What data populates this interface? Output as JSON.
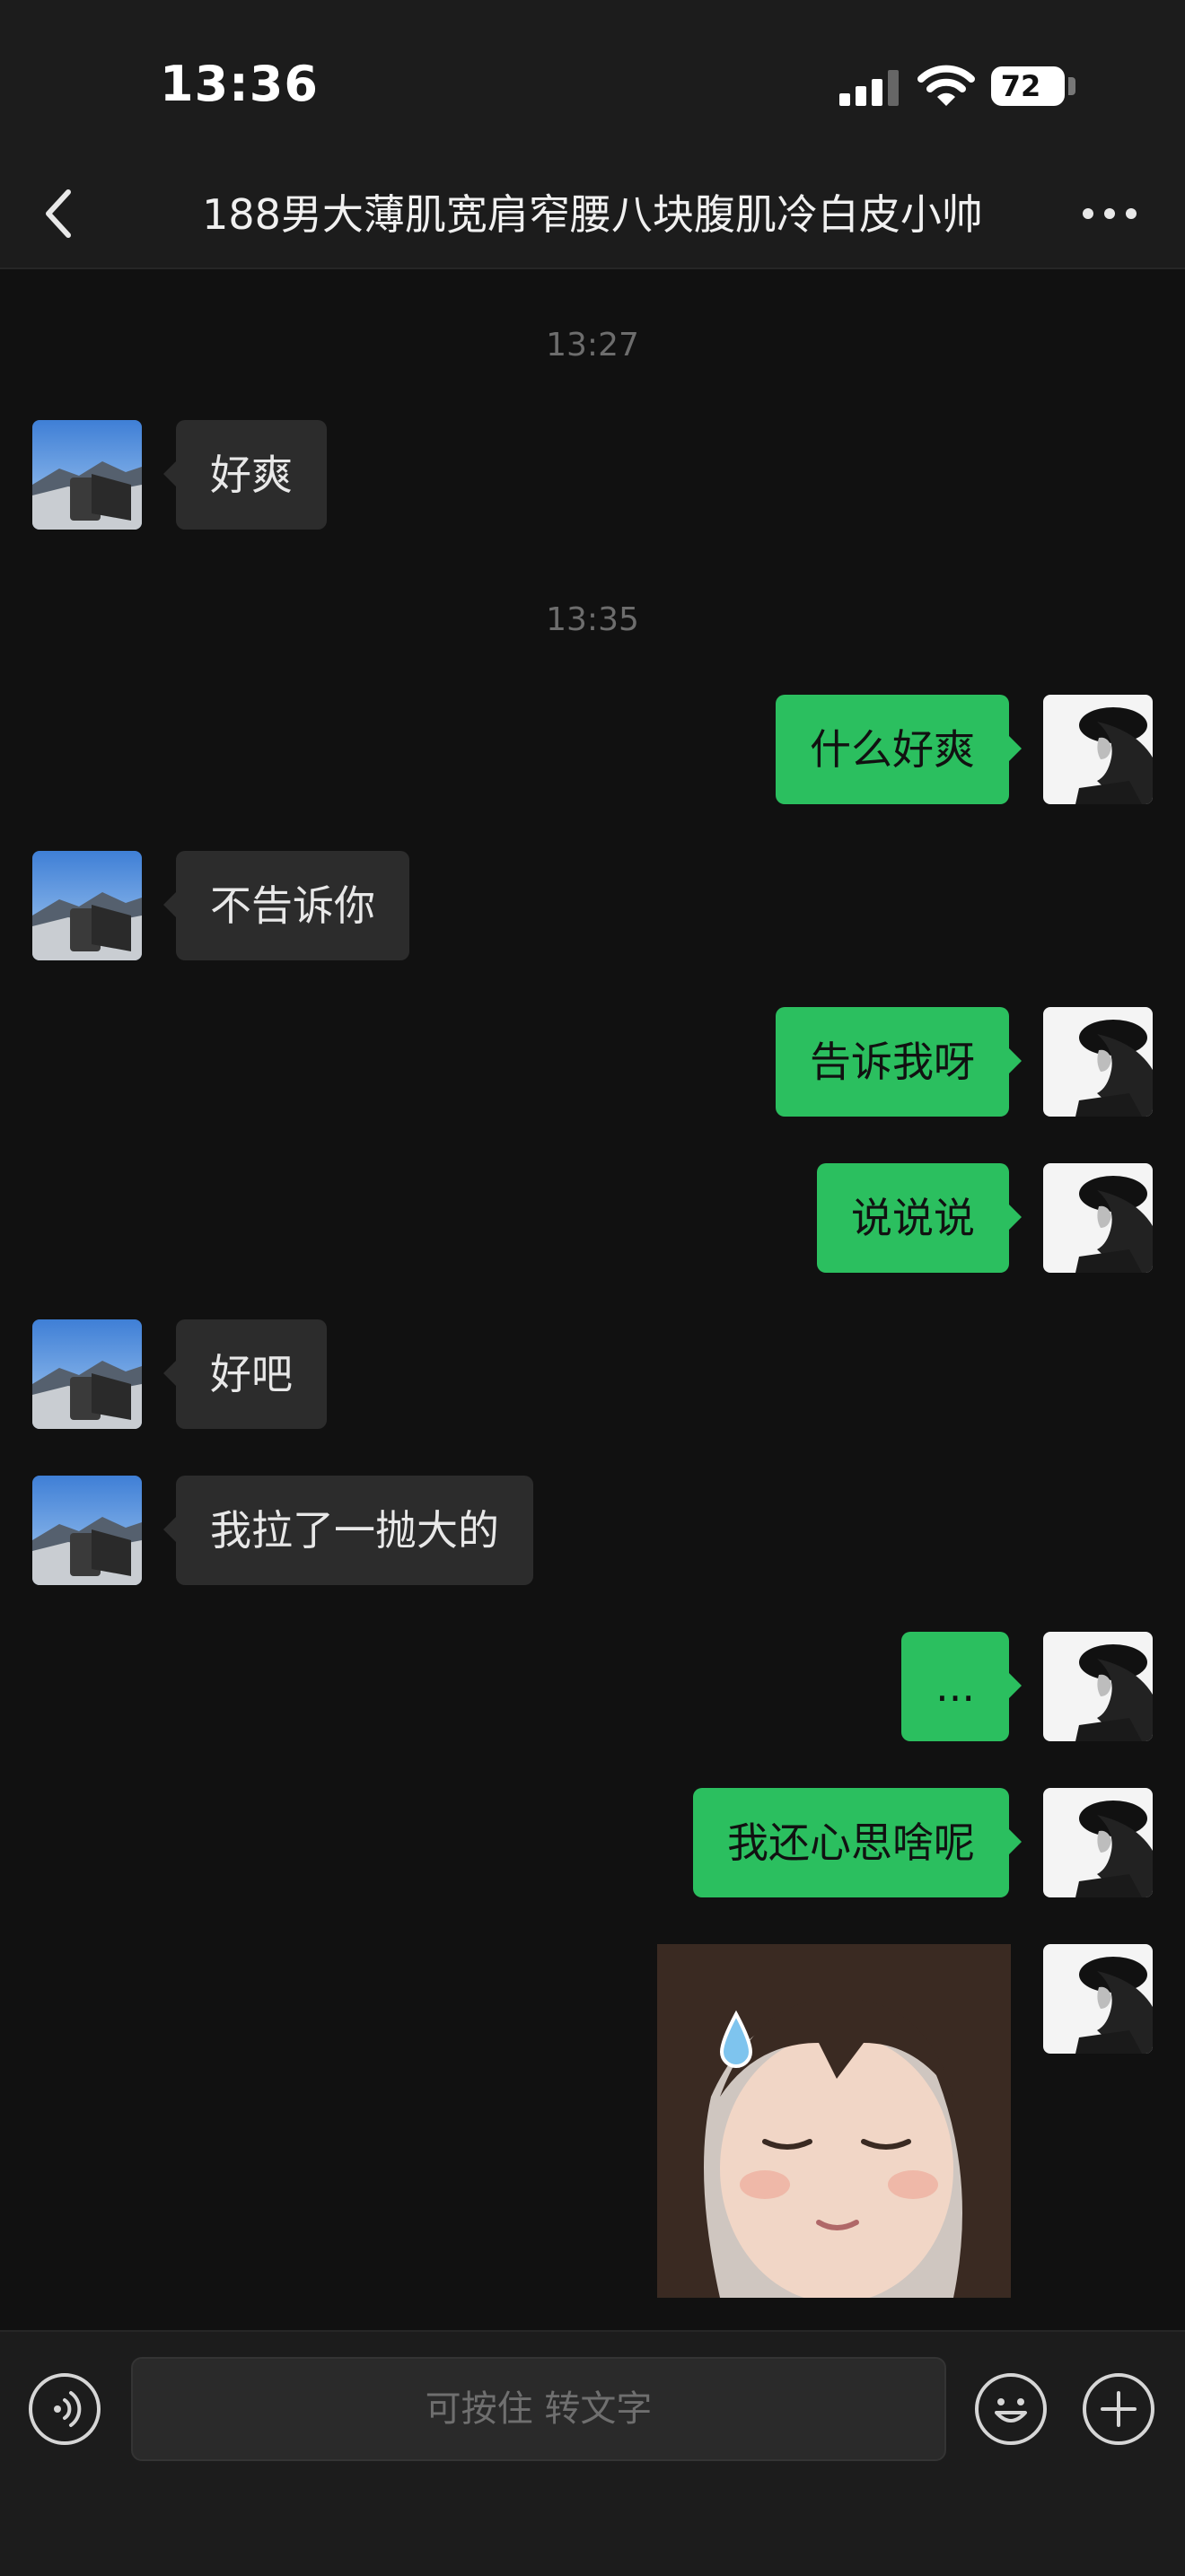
{
  "status_bar": {
    "time": "13:36",
    "battery": "72"
  },
  "nav": {
    "title": "188男大薄肌宽肩窄腰八块腹肌冷白皮小帅"
  },
  "chat": {
    "timestamps": [
      "13:27",
      "13:35"
    ],
    "messages": [
      {
        "from": "them",
        "text": "好爽"
      },
      {
        "from": "me",
        "text": "什么好爽"
      },
      {
        "from": "them",
        "text": "不告诉你"
      },
      {
        "from": "me",
        "text": "告诉我呀"
      },
      {
        "from": "me",
        "text": "说说说"
      },
      {
        "from": "them",
        "text": "好吧"
      },
      {
        "from": "them",
        "text": "我拉了一抛大的"
      },
      {
        "from": "me",
        "text": "..."
      },
      {
        "from": "me",
        "text": "我还心思啥呢"
      },
      {
        "from": "me",
        "type": "sticker"
      }
    ]
  },
  "input_bar": {
    "placeholder": "可按住 转文字"
  },
  "colors": {
    "bubble_out": "#2bbf5f",
    "bubble_in": "#2c2c2c",
    "background": "#111111"
  }
}
